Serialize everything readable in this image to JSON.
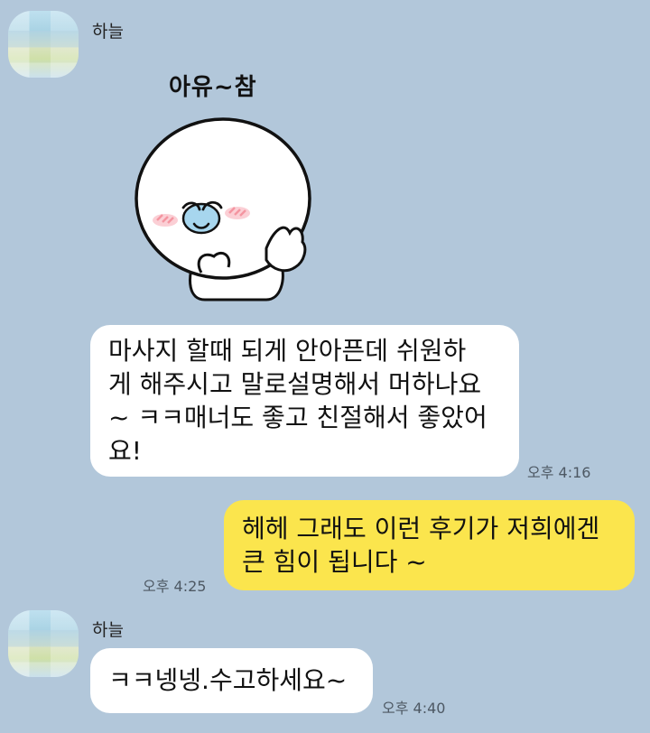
{
  "colors": {
    "background": "#b2c7da",
    "bubble_incoming": "#ffffff",
    "bubble_outgoing": "#fbe54d"
  },
  "messages": [
    {
      "type": "sticker",
      "sender": "하늘",
      "caption": "아유~참"
    },
    {
      "type": "text",
      "sender": "하늘",
      "lines": [
        "마사지 할때 되게 안아픈데 쉬원하",
        "게 해주시고 말로설명해서 머하나요",
        "~ ㅋㅋ매너도 좋고 친절해서 좋았어",
        "요!"
      ],
      "time": "오후 4:16"
    },
    {
      "type": "text",
      "sender": "me",
      "lines": [
        "헤헤 그래도 이런 후기가 저희에겐",
        "큰 힘이 됩니다 ~"
      ],
      "time": "오후 4:25"
    },
    {
      "type": "text",
      "sender": "하늘",
      "lines": [
        "ㅋㅋ넹넹.수고하세요~"
      ],
      "time": "오후 4:40"
    }
  ]
}
